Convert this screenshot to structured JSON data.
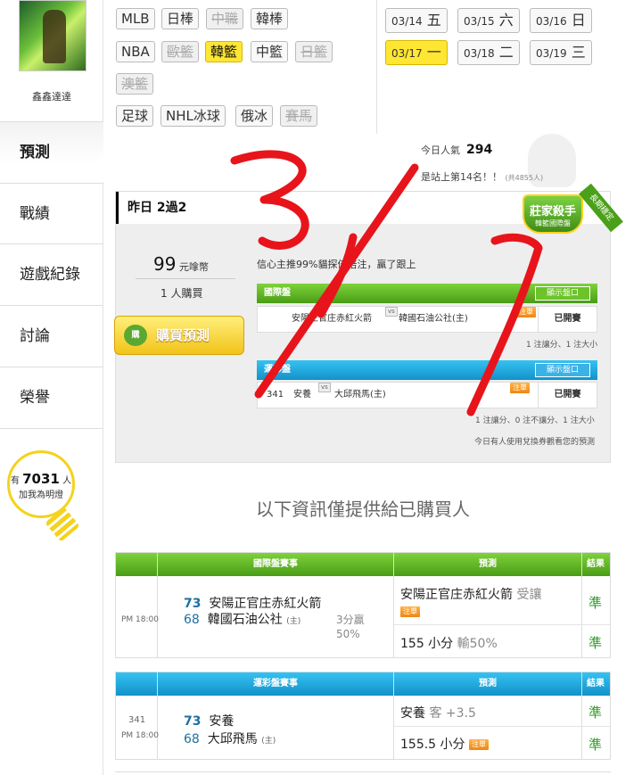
{
  "sidebar": {
    "username": "鑫鑫達達",
    "nav": [
      "預測",
      "戰績",
      "遊戲紀錄",
      "討論",
      "榮譽"
    ],
    "active": "預測",
    "bulb": {
      "prefix": "有",
      "count": "7031",
      "suffix": "人",
      "line2": "加我為明燈"
    }
  },
  "sports": {
    "row1": [
      {
        "label": "MLB",
        "state": "on"
      },
      {
        "label": "日棒",
        "state": "on"
      },
      {
        "label": "中職",
        "state": "off"
      },
      {
        "label": "韓棒",
        "state": "on"
      }
    ],
    "row2": [
      {
        "label": "NBA",
        "state": "on"
      },
      {
        "label": "歐籃",
        "state": "off"
      },
      {
        "label": "韓籃",
        "state": "selected"
      },
      {
        "label": "中籃",
        "state": "on"
      },
      {
        "label": "日籃",
        "state": "off"
      }
    ],
    "row3": [
      {
        "label": "澳籃",
        "state": "off"
      }
    ],
    "row4": [
      {
        "label": "足球",
        "state": "on"
      },
      {
        "label": "NHL冰球",
        "state": "on"
      },
      {
        "label": "俄冰",
        "state": "on"
      },
      {
        "label": "賽馬",
        "state": "off"
      }
    ]
  },
  "dates": [
    {
      "date": "03/14",
      "day": "五",
      "selected": false
    },
    {
      "date": "03/15",
      "day": "六",
      "selected": false
    },
    {
      "date": "03/16",
      "day": "日",
      "selected": false
    },
    {
      "date": "03/17",
      "day": "一",
      "selected": true
    },
    {
      "date": "03/18",
      "day": "二",
      "selected": false
    },
    {
      "date": "03/19",
      "day": "三",
      "selected": false
    }
  ],
  "popularity": {
    "label": "今日人氣",
    "value": "294",
    "rank_text": "是站上第14名！！",
    "rank_total": "(共4855人)"
  },
  "panel": {
    "title": "昨日 2過2",
    "price_value": "99",
    "price_unit": "元嗱幣",
    "buyers": "1 人購買",
    "buy_label": "購買預測",
    "buy_icon": "購",
    "desc": "信心主推99%貓探倍倍注，贏了跟上",
    "badge_title": "莊家殺手",
    "badge_sub": "韓籃國際盤",
    "badge_ribbon": "長期穩定",
    "sections": [
      {
        "header": "國際盤",
        "color": "#4a9c16",
        "show_label": "顯示盤口",
        "row_text": "安陽正官庄赤紅火箭",
        "vs": "vs",
        "row_text2": "韓國石油公社(主)",
        "tag": "注單",
        "status": "已開賽",
        "note": "1 注讓分、1 注大小"
      },
      {
        "header": "運彩盤",
        "color": "#1391c9",
        "show_label": "顯示盤口",
        "num": "341",
        "row_text": "安養",
        "vs": "vs",
        "row_text2": "大邱飛馬(主)",
        "tag": "注單",
        "status": "已開賽",
        "note": "1 注讓分、0 注不讓分、1 注大小"
      }
    ],
    "footer_note": "今日有人使用兌換券觀看您的預測"
  },
  "only_text": "以下資訊僅提供給已購買人",
  "table1": {
    "h1": "國際盤賽事",
    "h2": "預測",
    "h3": "結果",
    "time": "PM 18:00",
    "score1": "73",
    "team1": "安陽正官庄赤紅火箭",
    "score2": "68",
    "team2": "韓國石油公社",
    "home": "(主)",
    "result_note": "3分贏",
    "result_pct": "50%",
    "pick1": "安陽正官庄赤紅火箭",
    "pick1_extra": "受讓",
    "pick1_tag": "注單",
    "pick2": "155 小分",
    "pick2_extra": "輸50%",
    "res1": "準",
    "res2": "準"
  },
  "table2": {
    "h1": "運彩盤賽事",
    "h2": "預測",
    "h3": "結果",
    "num": "341",
    "time": "PM 18:00",
    "score1": "73",
    "team1": "安養",
    "score2": "68",
    "team2": "大邱飛馬",
    "home": "(主)",
    "pick1": "安養",
    "pick1_extra": "客 +3.5",
    "pick2": "155.5 小分",
    "pick2_tag": "注單",
    "res1": "準",
    "res2": "準"
  },
  "handwriting": "3/17",
  "colors": {
    "accent_yellow": "#ffe632",
    "green": "#4a9c16",
    "blue": "#1391c9",
    "ink": "#e8141b"
  }
}
